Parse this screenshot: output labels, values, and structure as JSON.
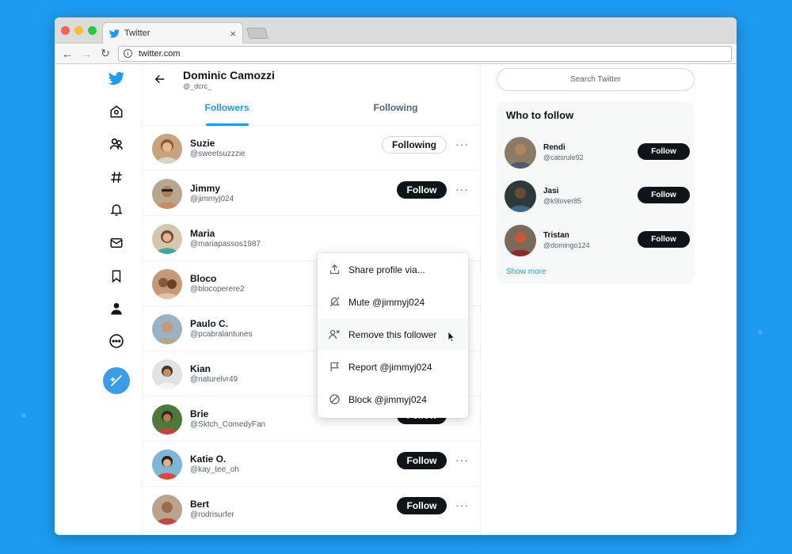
{
  "browser": {
    "tab_title": "Twitter",
    "tab_close": "×",
    "url": "twitter.com",
    "back_glyph": "←",
    "forward_glyph": "→",
    "reload_glyph": "↻",
    "info_glyph": "i"
  },
  "colors": {
    "brand_blue": "#1d9bf0",
    "text_dark": "#0f1419",
    "text_muted": "#536471"
  },
  "left_nav": {
    "items": [
      {
        "icon": "twitter-logo-icon"
      },
      {
        "icon": "explore-icon"
      },
      {
        "icon": "communities-icon"
      },
      {
        "icon": "hashtag-icon"
      },
      {
        "icon": "bell-icon"
      },
      {
        "icon": "mail-icon"
      },
      {
        "icon": "bookmark-icon"
      },
      {
        "icon": "profile-icon"
      },
      {
        "icon": "more-circle-icon"
      }
    ],
    "compose_icon": "compose-icon"
  },
  "profile": {
    "name": "Dominic Camozzi",
    "handle": "@_dcrc_"
  },
  "tabs": [
    {
      "label": "Followers",
      "active": true
    },
    {
      "label": "Following",
      "active": false
    }
  ],
  "followers": [
    {
      "name": "Suzie",
      "handle": "@sweetsuzzzie",
      "button": "Following"
    },
    {
      "name": "Jimmy",
      "handle": "@jimmyj024",
      "button": "Follow"
    },
    {
      "name": "Maria",
      "handle": "@mariapassos1987",
      "button": ""
    },
    {
      "name": "Bloco",
      "handle": "@blocoperere2",
      "button": ""
    },
    {
      "name": "Paulo C.",
      "handle": "@pcabralantunes",
      "button": ""
    },
    {
      "name": "Kian",
      "handle": "@naturelvr49",
      "button": ""
    },
    {
      "name": "Brie",
      "handle": "@Sktch_ComedyFan",
      "button": "Follow"
    },
    {
      "name": "Katie O.",
      "handle": "@kay_tee_oh",
      "button": "Follow"
    },
    {
      "name": "Bert",
      "handle": "@rodrisurfer",
      "button": "Follow"
    }
  ],
  "more_glyph": "···",
  "menu": {
    "items": [
      {
        "label": "Share profile via...",
        "icon": "share-icon"
      },
      {
        "label": "Mute @jimmyj024",
        "icon": "mute-icon"
      },
      {
        "label": "Remove this follower",
        "icon": "remove-follower-icon"
      },
      {
        "label": "Report @jimmyj024",
        "icon": "flag-icon"
      },
      {
        "label": "Block @jimmyj024",
        "icon": "block-icon"
      }
    ]
  },
  "sidebar": {
    "search_placeholder": "Search Twitter",
    "who_to_follow": {
      "title": "Who to follow",
      "suggestions": [
        {
          "name": "Rendi",
          "handle": "@catsrule92",
          "button": "Follow"
        },
        {
          "name": "Jasi",
          "handle": "@k9lover85",
          "button": "Follow"
        },
        {
          "name": "Tristan",
          "handle": "@domingo124",
          "button": "Follow"
        }
      ],
      "show_more": "Show more"
    }
  }
}
